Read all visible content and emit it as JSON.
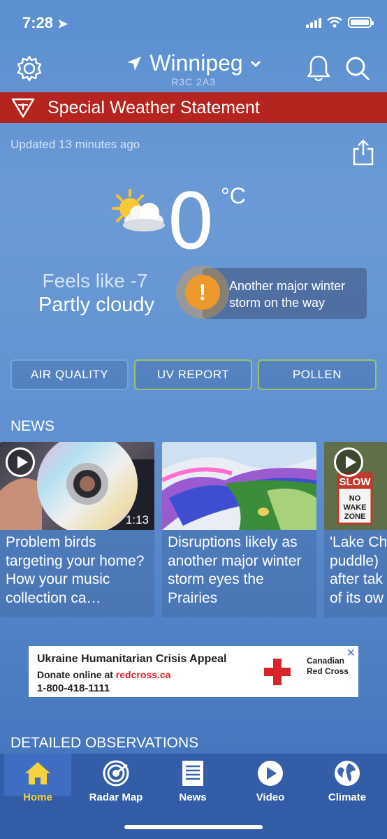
{
  "status_bar": {
    "time": "7:28"
  },
  "header": {
    "city": "Winnipeg",
    "postal_code": "R3C 2A3"
  },
  "alert_banner": {
    "label": "Special Weather Statement"
  },
  "updated": "Updated 13 minutes ago",
  "current": {
    "temperature": "0",
    "unit": "°C",
    "feels_like": "Feels like -7",
    "condition": "Partly cloudy",
    "alert_text": "Another major winter storm on the way"
  },
  "pills": {
    "air_quality": "AIR QUALITY",
    "uv_report": "UV REPORT",
    "pollen": "POLLEN"
  },
  "news": {
    "title": "NEWS",
    "items": [
      {
        "headline": "Problem birds targeting your home? How your music collection ca…",
        "duration": "1:13"
      },
      {
        "headline": "Disruptions likely as another major winter storm eyes the Prairies"
      },
      {
        "headline": "'Lake Ch puddle) after tak of its ow"
      }
    ]
  },
  "ad": {
    "title": "Ukraine Humanitarian Crisis Appeal",
    "line2_prefix": "Donate online at ",
    "line2_link": "redcross.ca",
    "phone": "1-800-418-1111",
    "brand_line1": "Canadian",
    "brand_line2": "Red Cross"
  },
  "detailed": {
    "title": "DETAILED OBSERVATIONS"
  },
  "tabs": {
    "home": "Home",
    "radar": "Radar Map",
    "news": "News",
    "video": "Video",
    "climate": "Climate"
  },
  "colors": {
    "alert_red": "#b5241e",
    "alert_orange": "#ec9a2c",
    "active_tab": "#f6d23c"
  }
}
